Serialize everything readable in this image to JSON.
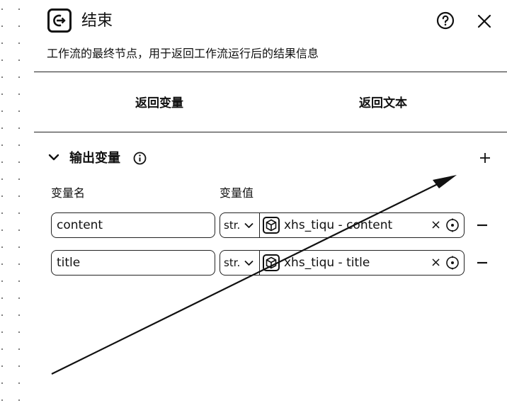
{
  "header": {
    "title": "结束",
    "description": "工作流的最终节点，用于返回工作流运行后的结果信息",
    "node_icon": "exit-node-icon",
    "help_icon": "help-circle-icon",
    "close_icon": "close-icon"
  },
  "tabs": [
    {
      "label": "返回变量"
    },
    {
      "label": "返回文本"
    }
  ],
  "output_section": {
    "title": "输出变量",
    "info_icon": "info-circle-icon",
    "add_icon": "plus-icon",
    "columns": {
      "name": "变量名",
      "value": "变量值"
    },
    "rows": [
      {
        "name": "content",
        "type": "str.",
        "ref": "xhs_tiqu - content",
        "clear": "×"
      },
      {
        "name": "title",
        "type": "str.",
        "ref": "xhs_tiqu - title",
        "clear": "×"
      }
    ]
  },
  "colors": {
    "ink": "#111111",
    "background": "#ffffff"
  }
}
